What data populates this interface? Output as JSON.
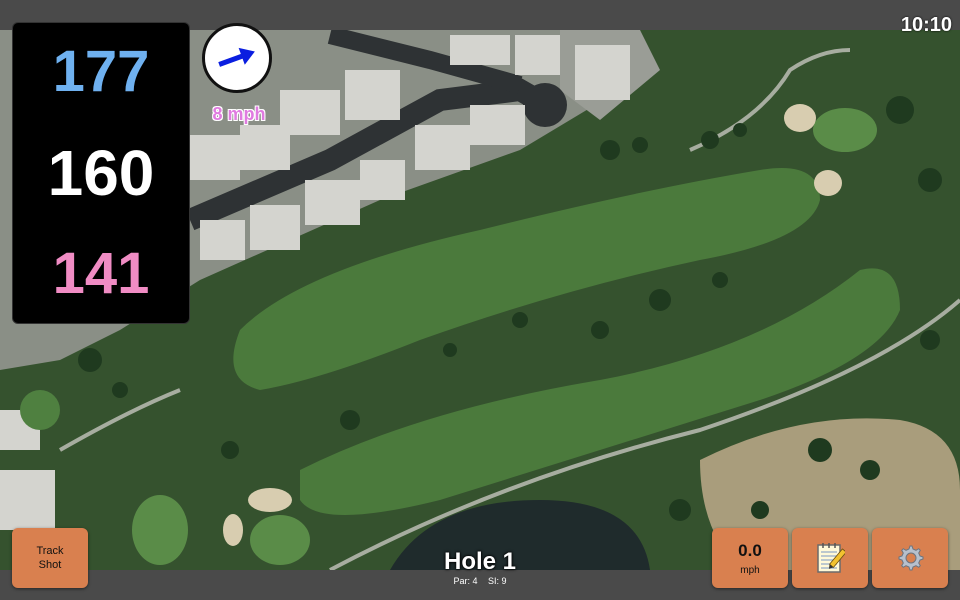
{
  "status": {
    "time": "10:10"
  },
  "yardage": {
    "back": "177",
    "center": "160",
    "front": "141"
  },
  "wind": {
    "speed": "8 mph",
    "icon": "arrow-right-icon"
  },
  "hole": {
    "title": "Hole 1",
    "par": "Par: 4",
    "si": "SI: 9"
  },
  "buttons": {
    "track_line1": "Track",
    "track_line2": "Shot",
    "speed_value": "0.0",
    "speed_unit": "mph",
    "notes_icon": "notepad-icon",
    "settings_icon": "gear-icon"
  },
  "colors": {
    "back": "#6fb1f0",
    "center": "#ffffff",
    "front": "#f08cc4",
    "button": "#d9804f",
    "wind_text": "#e07be0"
  }
}
